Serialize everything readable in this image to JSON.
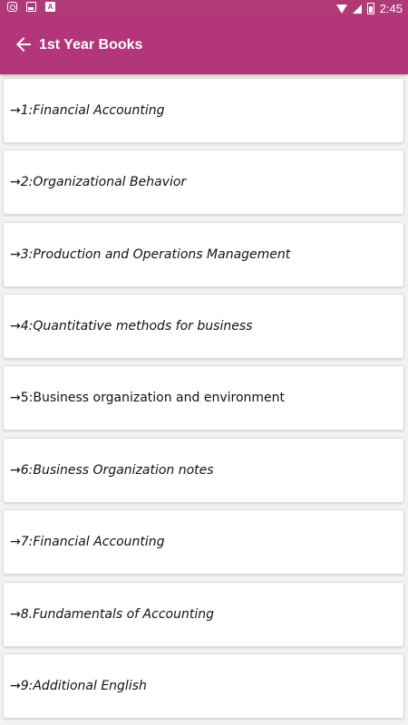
{
  "status_bar": {
    "time": "2:45",
    "left_icons": [
      "instagram-icon",
      "image-icon",
      "font-icon"
    ],
    "right_icons": [
      "wifi-icon",
      "signal-icon",
      "battery-icon"
    ]
  },
  "app_bar": {
    "title": "1st Year Books",
    "back_icon": "arrow-left-icon",
    "color": "#b3367a"
  },
  "books": [
    {
      "label": "→1:Financial Accounting",
      "italic": true
    },
    {
      "label": "→2:Organizational Behavior",
      "italic": true
    },
    {
      "label": "→3:Production and Operations Management",
      "italic": true
    },
    {
      "label": "→4:Quantitative methods for business",
      "italic": true
    },
    {
      "label": "→5:Business organization and environment",
      "italic": false
    },
    {
      "label": "→6:Business Organization notes",
      "italic": true
    },
    {
      "label": "→7:Financial Accounting",
      "italic": true
    },
    {
      "label": "→8.Fundamentals of Accounting",
      "italic": true
    },
    {
      "label": "→9:Additional English",
      "italic": true
    }
  ]
}
